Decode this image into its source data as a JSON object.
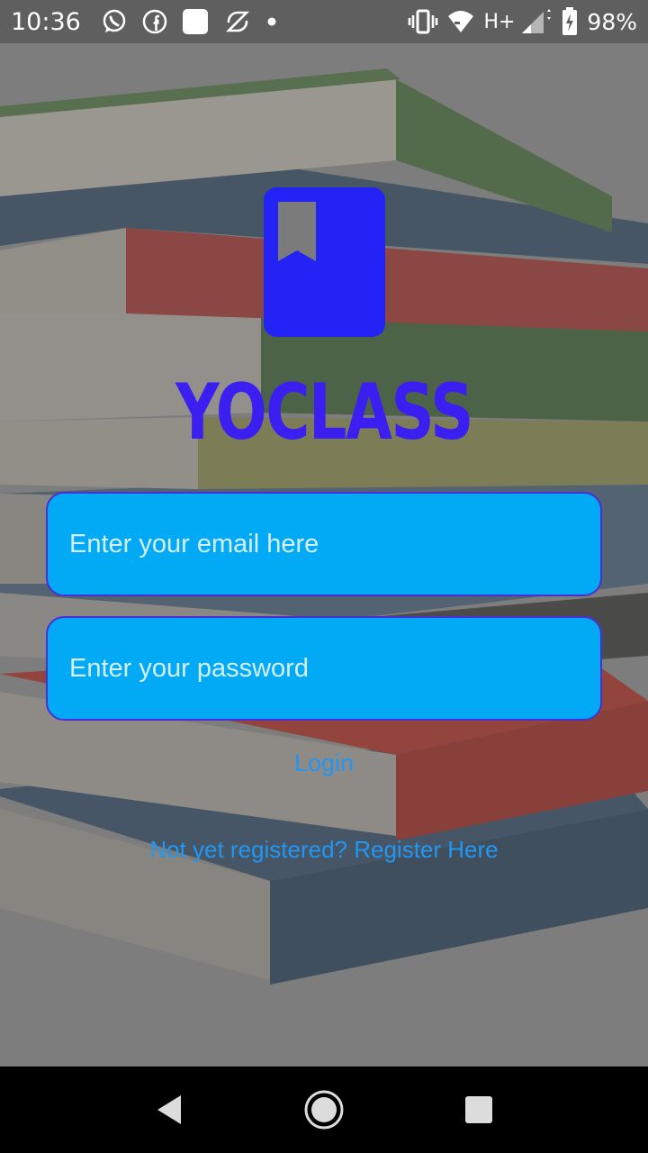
{
  "status_bar": {
    "time": "10:36",
    "network": "H+",
    "battery": "98%",
    "notification_icons": [
      "whatsapp-icon",
      "facebook-icon",
      "app-square-icon",
      "swiftkey-icon",
      "dot-icon"
    ],
    "system_icons": [
      "vibrate-icon",
      "wifi-icon",
      "signal-icon",
      "battery-icon"
    ]
  },
  "app": {
    "name": "YOCLASS",
    "logo_icon": "bookmark-book-icon",
    "logo_color": "#2323f5",
    "name_color": "#3b1ff0"
  },
  "form": {
    "email_placeholder": "Enter your email here",
    "email_value": "",
    "password_placeholder": "Enter your password",
    "password_value": "",
    "login_label": "Login",
    "register_label": "Not yet registered? Register Here",
    "field_color": "#02aaf5",
    "link_color": "#2196f3"
  },
  "nav_bar": {
    "buttons": [
      "back-icon",
      "home-icon",
      "recents-icon"
    ]
  }
}
